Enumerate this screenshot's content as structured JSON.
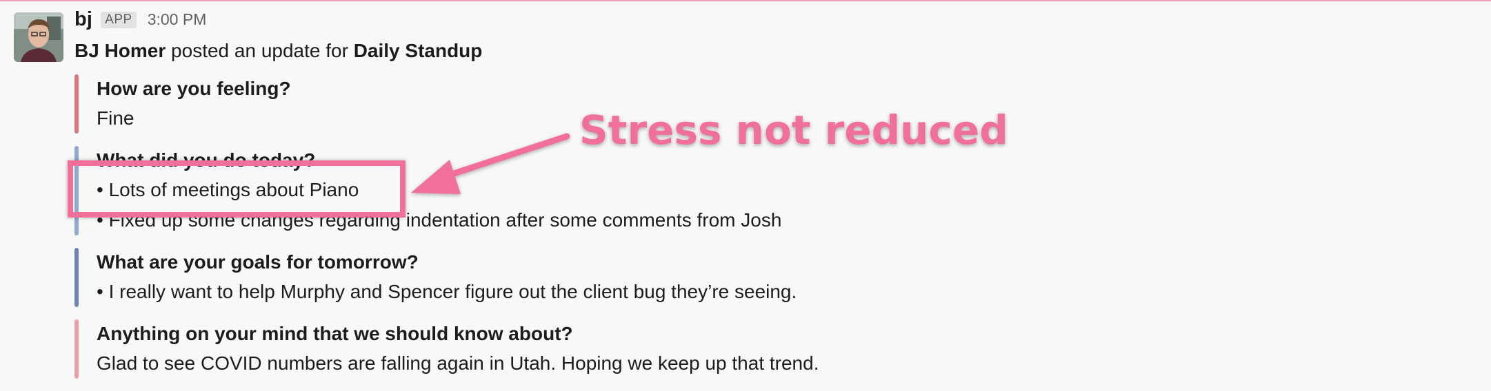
{
  "message": {
    "sender": "bj",
    "badge": "APP",
    "time": "3:00 PM",
    "summary": {
      "author": "BJ Homer",
      "middle": " posted an update for ",
      "target": "Daily Standup"
    }
  },
  "attachments": [
    {
      "question": "How are you feeling?",
      "answers": [
        "Fine"
      ],
      "color": "#d97b7b"
    },
    {
      "question": "What did you do today?",
      "answers": [
        "• Lots of meetings about Piano",
        "• Fixed up some changes regarding indentation after some comments from Josh"
      ],
      "color": "#8fa9cf"
    },
    {
      "question": "What are your goals for tomorrow?",
      "answers": [
        "• I really want to help Murphy and Spencer figure out the client bug they’re seeing."
      ],
      "color": "#6b85b0"
    },
    {
      "question": "Anything on your mind that we should know about?",
      "answers": [
        "Glad to see COVID numbers are falling again in Utah. Hoping we keep up that trend."
      ],
      "color": "#e8a0a6"
    }
  ],
  "annotation": {
    "text": "Stress not reduced",
    "color": "#f1709a"
  }
}
